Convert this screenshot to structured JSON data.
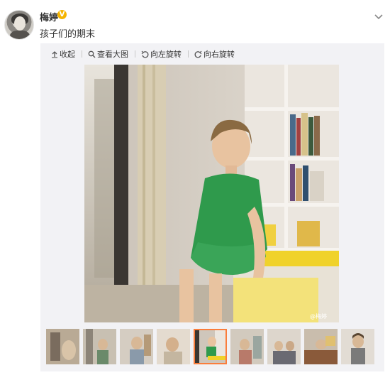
{
  "post": {
    "username": "梅婷",
    "verified_badge": "V",
    "text": "孩子们的期末"
  },
  "toolbar": {
    "collapse_label": "收起",
    "view_large_label": "查看大图",
    "rotate_left_label": "向左旋转",
    "rotate_right_label": "向右旋转"
  },
  "photo": {
    "watermark": "@梅婷",
    "icons": [
      "collapse-icon",
      "magnifier-icon",
      "rotate-left-icon",
      "rotate-right-icon",
      "chevron-down-icon"
    ]
  },
  "thumbnails": {
    "count": 9,
    "selected_index": 4
  },
  "colors": {
    "accent": "#fa7d3c",
    "badge": "#f5b400",
    "panel": "#f2f2f5"
  }
}
